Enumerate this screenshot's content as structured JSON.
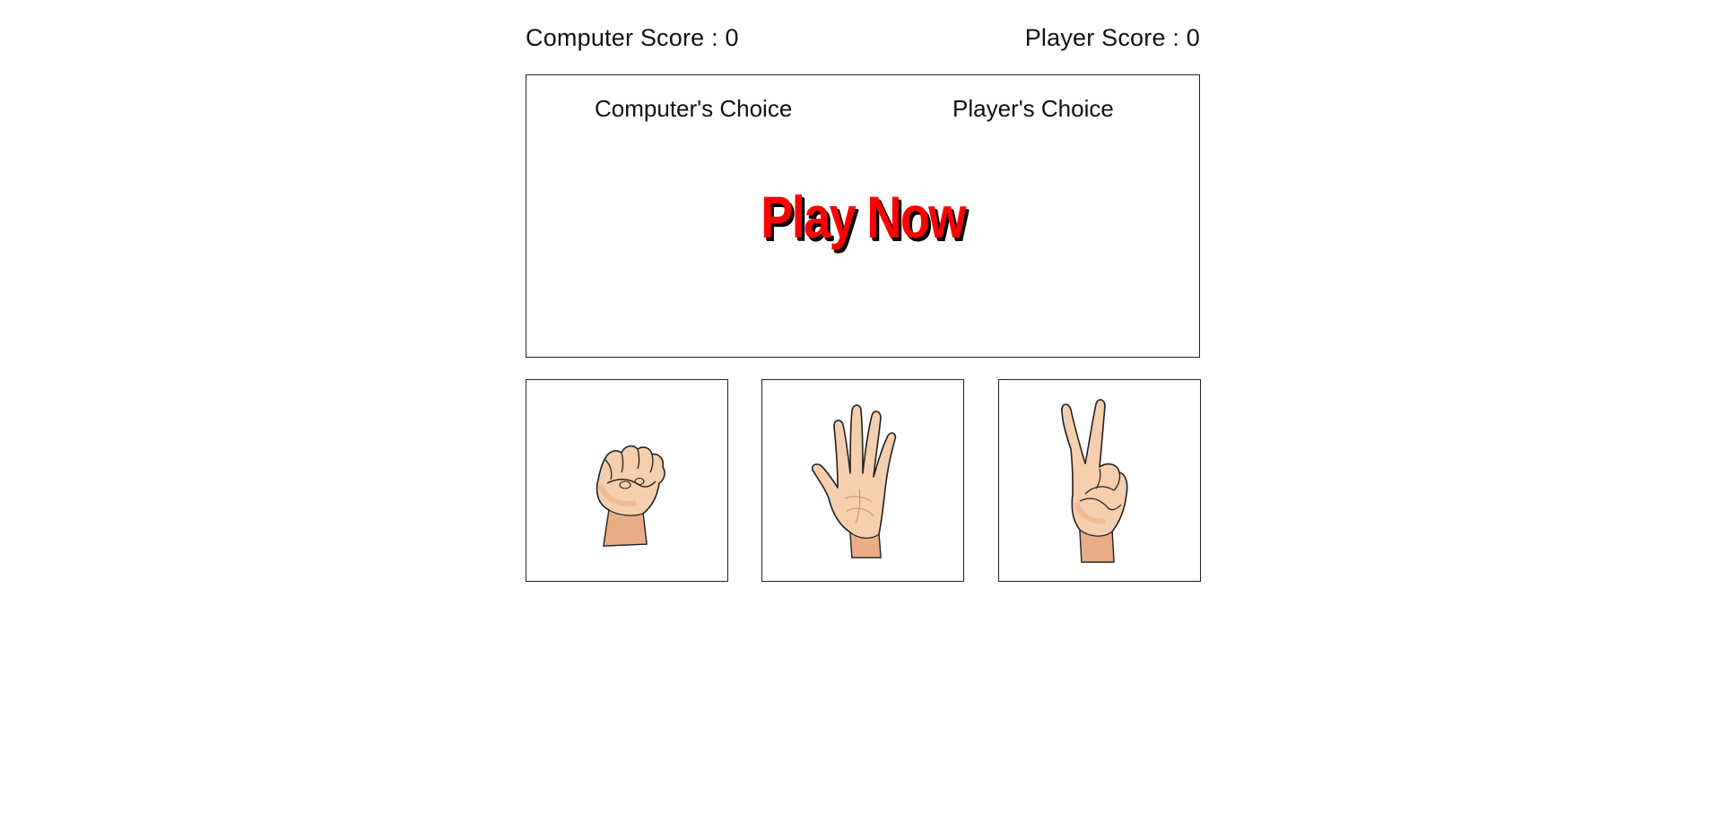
{
  "scores": {
    "computer_label": "Computer Score : 0",
    "player_label": "Player Score : 0"
  },
  "arena": {
    "computer_choice_label": "Computer's Choice",
    "player_choice_label": "Player's Choice",
    "play_button_label": "Play Now"
  },
  "options": [
    {
      "name": "rock",
      "icon": "fist-hand-icon"
    },
    {
      "name": "paper",
      "icon": "open-hand-icon"
    },
    {
      "name": "scissors",
      "icon": "peace-sign-hand-icon"
    }
  ],
  "colors": {
    "play_text": "#ff0000",
    "play_shadow": "#000000",
    "skin": "#f6cfae",
    "skin_shadow": "#e9ae87",
    "border": "#222222"
  }
}
